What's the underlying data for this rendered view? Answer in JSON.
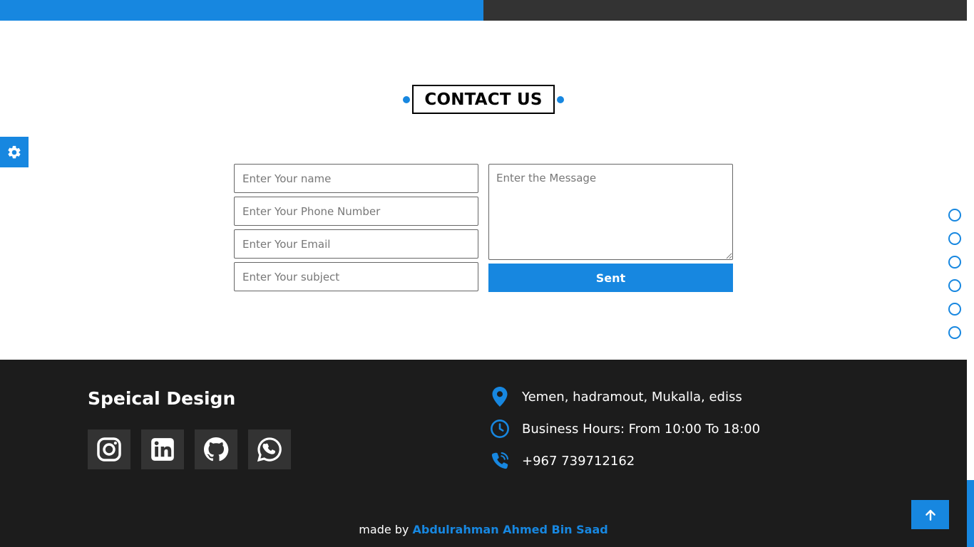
{
  "section": {
    "title": "CONTACT US"
  },
  "form": {
    "name_placeholder": "Enter Your name",
    "phone_placeholder": "Enter Your Phone Number",
    "email_placeholder": "Enter Your Email",
    "subject_placeholder": "Enter Your subject",
    "message_placeholder": "Enter the Message",
    "submit_label": "Sent"
  },
  "nav_bullets": {
    "count": 6
  },
  "footer": {
    "brand": "Speical Design",
    "socials": [
      {
        "icon": "instagram-icon"
      },
      {
        "icon": "linkedin-icon"
      },
      {
        "icon": "github-icon"
      },
      {
        "icon": "whatsapp-icon"
      }
    ],
    "info": {
      "address": "Yemen, hadramout, Mukalla, ediss",
      "hours": "Business Hours: From 10:00 To 18:00",
      "phone": "+967 739712162"
    },
    "credit_prefix": "made by",
    "credit_author": "Abdulrahman Ahmed Bin Saad"
  },
  "colors": {
    "accent": "#1787e0",
    "footer_bg": "#1c1c1c",
    "social_bg": "#333333"
  }
}
